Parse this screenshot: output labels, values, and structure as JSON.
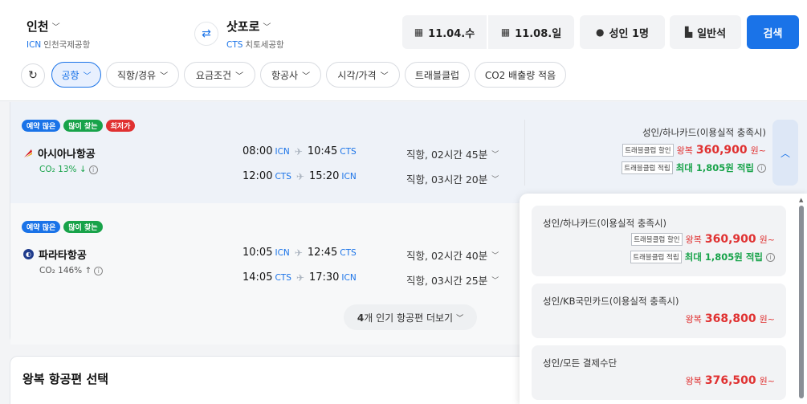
{
  "header": {
    "origin": {
      "city": "인천",
      "code": "ICN",
      "airport": "인천국제공항"
    },
    "destination": {
      "city": "삿포로",
      "code": "CTS",
      "airport": "치토세공항"
    },
    "depart_date": "11.04.수",
    "return_date": "11.08.일",
    "passengers": "성인 1명",
    "cabin": "일반석",
    "search_label": "검색"
  },
  "filters": [
    {
      "label": "공항",
      "active": true
    },
    {
      "label": "직항/경유"
    },
    {
      "label": "요금조건"
    },
    {
      "label": "항공사"
    },
    {
      "label": "시각/가격"
    },
    {
      "label": "트래블클럽"
    },
    {
      "label": "CO2 배출량 적음"
    }
  ],
  "flights": [
    {
      "badges": [
        "예약 많은",
        "많이 찾는",
        "최저가"
      ],
      "airline": "아시아나항공",
      "co2": "CO₂ 13% ↓",
      "out": {
        "dep": "08:00",
        "dep_ap": "ICN",
        "arr": "10:45",
        "arr_ap": "CTS",
        "dur": "직항, 02시간 45분"
      },
      "ret": {
        "dep": "12:00",
        "dep_ap": "CTS",
        "arr": "15:20",
        "arr_ap": "ICN",
        "dur": "직항, 03시간 20분"
      },
      "price_title": "성인/하나카드(이용실적 충족시)",
      "discount_tag": "트래블클럽 할인",
      "price_label": "왕복",
      "price": "360,900",
      "won": "원~",
      "reward_tag": "트래블클럽 적립",
      "reward": "최대 1,805원 적립"
    },
    {
      "badges": [
        "예약 많은",
        "많이 찾는"
      ],
      "airline": "파라타항공",
      "co2": "CO₂ 146% ↑",
      "out": {
        "dep": "10:05",
        "dep_ap": "ICN",
        "arr": "12:45",
        "arr_ap": "CTS",
        "dur": "직항, 02시간 40분"
      },
      "ret": {
        "dep": "14:05",
        "dep_ap": "CTS",
        "arr": "17:30",
        "arr_ap": "ICN",
        "dur": "직항, 03시간 25분"
      }
    }
  ],
  "more_button": {
    "count": "4",
    "rest": "개 인기 항공편 더보기"
  },
  "section_title": "왕복 항공편 선택",
  "dropdown": [
    {
      "title": "성인/하나카드(이용실적 충족시)",
      "discount_tag": "트래블클럽 할인",
      "label": "왕복",
      "price": "360,900",
      "won": "원~",
      "reward_tag": "트래블클럽 적립",
      "reward": "최대 1,805원 적립"
    },
    {
      "title": "성인/KB국민카드(이용실적 충족시)",
      "label": "왕복",
      "price": "368,800",
      "won": "원~"
    },
    {
      "title": "성인/모든 결제수단",
      "label": "왕복",
      "price": "376,500",
      "won": "원~"
    }
  ],
  "colors": {
    "accent": "#1a73e8",
    "price": "#e03131",
    "reward": "#18a34a"
  }
}
